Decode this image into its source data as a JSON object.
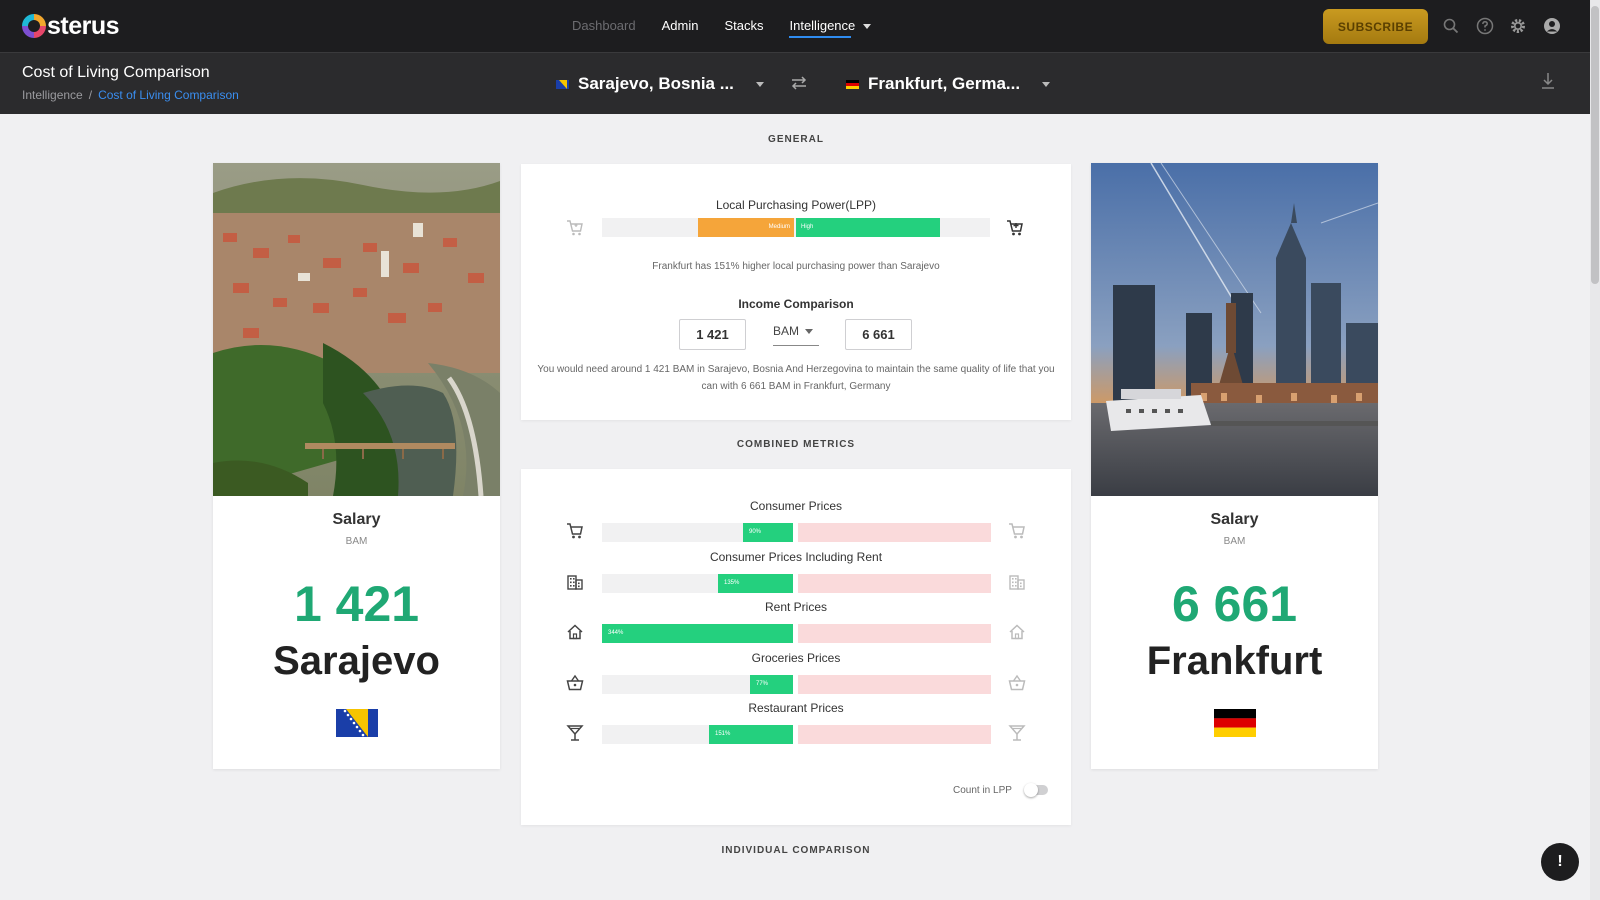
{
  "app": {
    "logo_text": "sterus"
  },
  "nav": {
    "items": [
      {
        "label": "Dashboard"
      },
      {
        "label": "Admin"
      },
      {
        "label": "Stacks"
      },
      {
        "label": "Intelligence"
      }
    ],
    "subscribe_label": "SUBSCRIBE"
  },
  "header": {
    "title": "Cost of Living Comparison",
    "breadcrumb": [
      "Intelligence",
      "Cost of Living Comparison"
    ],
    "breadcrumb_sep": "/",
    "city_a": "Sarajevo, Bosnia ...",
    "city_b": "Frankfurt, Germa..."
  },
  "sections": {
    "general": "GENERAL",
    "combined": "COMBINED METRICS",
    "individual": "INDIVIDUAL COMPARISON"
  },
  "lpp": {
    "title": "Local Purchasing Power(LPP)",
    "medium_label": "Medium",
    "high_label": "High",
    "note": "Frankfurt has 151% higher local purchasing power than Sarajevo"
  },
  "income": {
    "title": "Income Comparison",
    "value_a": "1 421",
    "currency": "BAM",
    "value_b": "6 661",
    "note": "You would need around 1 421 BAM in Sarajevo, Bosnia And Herzegovina to maintain the same quality of life that you can with 6 661 BAM in Frankfurt, Germany"
  },
  "metrics": [
    {
      "title": "Consumer Prices",
      "label": "90%",
      "percent": 90,
      "icon": "cart-icon"
    },
    {
      "title": "Consumer Prices Including Rent",
      "label": "135%",
      "percent": 135,
      "icon": "building-icon"
    },
    {
      "title": "Rent Prices",
      "label": "344%",
      "percent": 344,
      "icon": "home-icon"
    },
    {
      "title": "Groceries Prices",
      "label": "77%",
      "percent": 77,
      "icon": "basket-icon"
    },
    {
      "title": "Restaurant Prices",
      "label": "151%",
      "percent": 151,
      "icon": "cocktail-icon"
    }
  ],
  "count_in_lpp": "Count in LPP",
  "city_cards": {
    "a": {
      "salary_label": "Salary",
      "currency": "BAM",
      "salary": "1 421",
      "city": "Sarajevo"
    },
    "b": {
      "salary_label": "Salary",
      "currency": "BAM",
      "salary": "6 661",
      "city": "Frankfurt"
    }
  },
  "fab_label": "!",
  "colors": {
    "accent": "#2f8cf0",
    "positive": "#24d07e",
    "salary": "#1fa874",
    "medium": "#f5a53a",
    "negative_bg": "#fadadb",
    "gold": "#c99a20"
  }
}
